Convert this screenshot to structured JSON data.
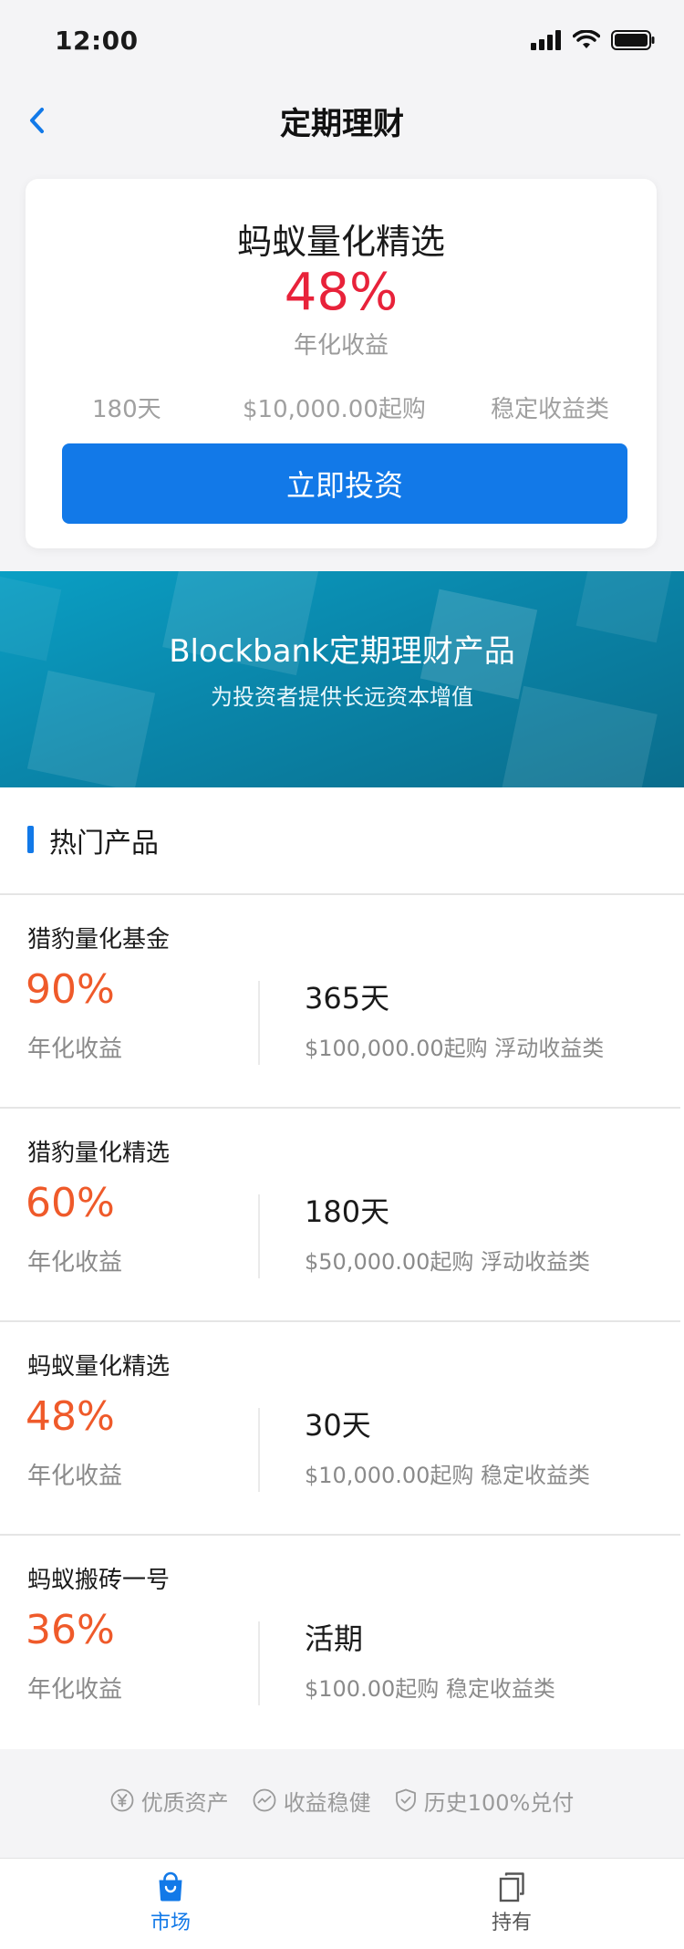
{
  "status_bar": {
    "time": "12:00"
  },
  "nav": {
    "title": "定期理财"
  },
  "featured": {
    "name": "蚂蚁量化精选",
    "rate": "48%",
    "rate_label": "年化收益",
    "term": "180天",
    "min_amount": "$10,000.00起购",
    "category": "稳定收益类",
    "button_label": "立即投资"
  },
  "banner": {
    "title": "Blockbank定期理财产品",
    "subtitle": "为投资者提供长远资本增值"
  },
  "hot_section": {
    "title": "热门产品"
  },
  "products": [
    {
      "name": "猎豹量化基金",
      "rate": "90%",
      "rate_label": "年化收益",
      "term": "365天",
      "description": "$100,000.00起购 浮动收益类"
    },
    {
      "name": "猎豹量化精选",
      "rate": "60%",
      "rate_label": "年化收益",
      "term": "180天",
      "description": "$50,000.00起购 浮动收益类"
    },
    {
      "name": "蚂蚁量化精选",
      "rate": "48%",
      "rate_label": "年化收益",
      "term": "30天",
      "description": "$10,000.00起购 稳定收益类"
    },
    {
      "name": "蚂蚁搬砖一号",
      "rate": "36%",
      "rate_label": "年化收益",
      "term": "活期",
      "description": "$100.00起购 稳定收益类"
    }
  ],
  "trust_badges": [
    {
      "icon": "yen-circle-icon",
      "label": "优质资产"
    },
    {
      "icon": "trend-circle-icon",
      "label": "收益稳健"
    },
    {
      "icon": "shield-check-icon",
      "label": "历史100%兑付"
    }
  ],
  "tab_bar": {
    "tabs": [
      {
        "label": "市场",
        "icon": "shopping-bag-icon",
        "active": true
      },
      {
        "label": "持有",
        "icon": "copy-icon",
        "active": false
      }
    ]
  },
  "colors": {
    "accent": "#1279e8",
    "featured_rate": "#e8223a",
    "product_rate": "#ef5a2a",
    "muted_text": "#9a9a9a"
  }
}
